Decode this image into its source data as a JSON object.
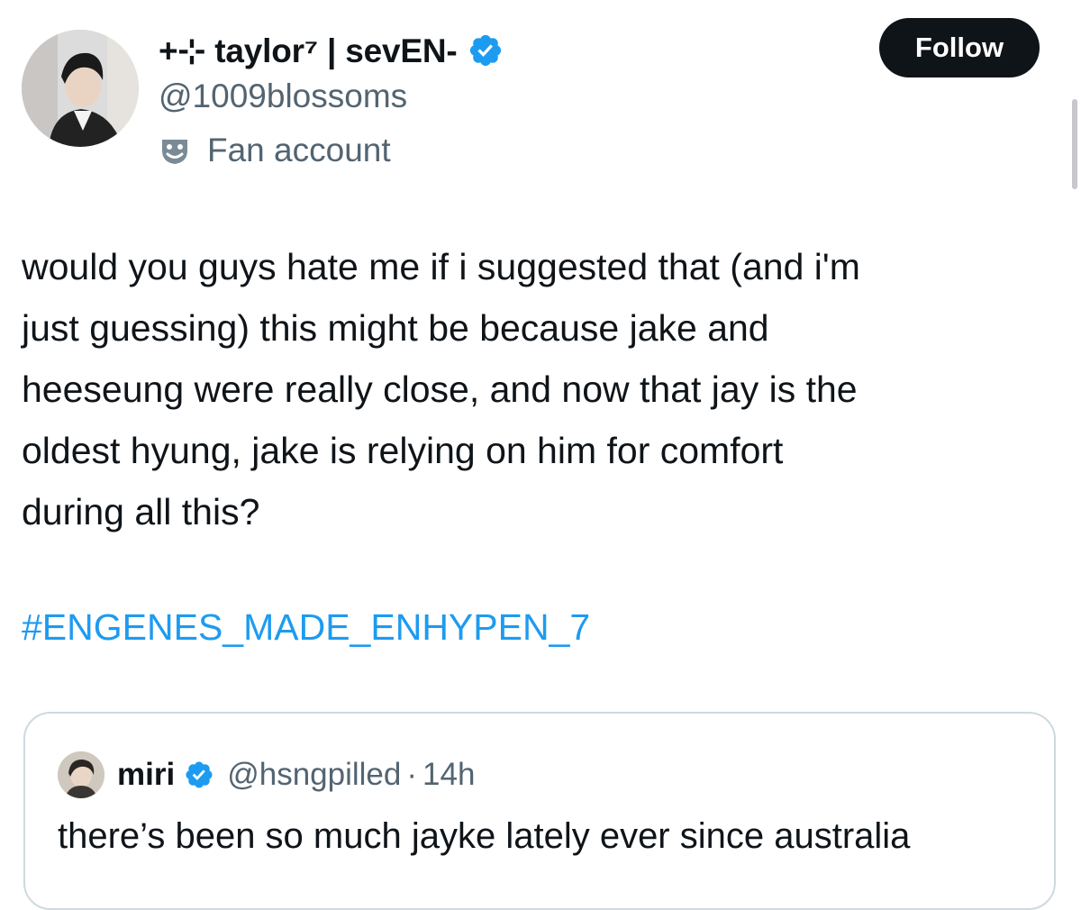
{
  "author": {
    "display_name": "+⊹ taylor⁷ | sevEN-",
    "handle": "@1009blossoms",
    "label": "Fan account",
    "label_icon": "theater-masks-icon",
    "avatar": "profile-photo",
    "verified_icon": "verified-badge-icon"
  },
  "follow_button": {
    "label": "Follow"
  },
  "tweet": {
    "lines": [
      "would you guys hate me if i suggested that (and i'm",
      "just guessing) this might be because jake and",
      "heeseung were really close, and now that jay is the",
      "oldest hyung, jake is relying on him for comfort",
      "during all this?"
    ],
    "hashtag": "#ENGENES_MADE_ENHYPEN_7"
  },
  "quoted_tweet": {
    "display_name": "miri",
    "handle": "@hsngpilled",
    "separator": "·",
    "time": "14h",
    "text": "there’s been so much jayke lately ever since australia",
    "verified_icon": "verified-badge-icon"
  },
  "colors": {
    "text": "#0f1419",
    "secondary": "#536471",
    "accent": "#1d9bf0",
    "border": "#cfd9de",
    "button_bg": "#0f1419"
  }
}
